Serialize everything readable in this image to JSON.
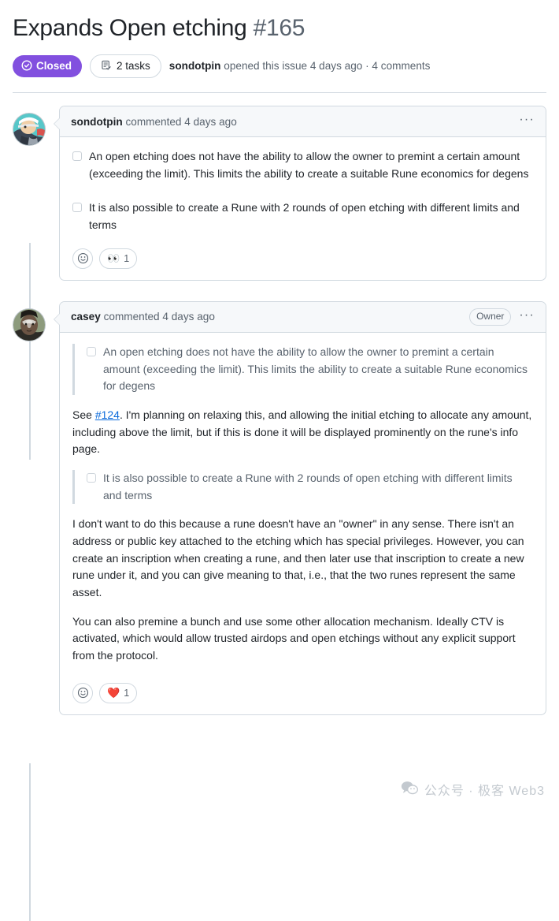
{
  "issue": {
    "title": "Expands Open etching",
    "number": "#165",
    "state_label": "Closed",
    "state_color": "#8250df",
    "tasks_label": "2 tasks",
    "meta_author": "sondotpin",
    "meta_text": " opened this issue 4 days ago · 4 comments"
  },
  "comments": [
    {
      "author": "sondotpin",
      "action": "commented 4 days ago",
      "badge": null,
      "kebab": "···",
      "tasks": [
        "An open etching does not have the ability to allow the owner to premint a certain amount (exceeding the limit). This limits the ability to create a suitable Rune economics for degens",
        "It is also possible to create a Rune with 2 rounds of open etching with different limits and terms"
      ],
      "reactions": [
        {
          "emoji": "👀",
          "count": "1",
          "name": "eyes-reaction"
        }
      ]
    },
    {
      "author": "casey",
      "action": "commented 4 days ago",
      "badge": "Owner",
      "kebab": "···",
      "quote1": "An open etching does not have the ability to allow the owner to premint a certain amount (exceeding the limit). This limits the ability to create a suitable Rune economics for degens",
      "para1_before": "See ",
      "para1_link": "#124",
      "para1_after": ". I'm planning on relaxing this, and allowing the initial etching to allocate any amount, including above the limit, but if this is done it will be displayed prominently on the rune's info page.",
      "quote2": "It is also possible to create a Rune with 2 rounds of open etching with different limits and terms",
      "para2": "I don't want to do this because a rune doesn't have an \"owner\" in any sense. There isn't an address or public key attached to the etching which has special privileges. However, you can create an inscription when creating a rune, and then later use that inscription to create a new rune under it, and you can give meaning to that, i.e., that the two runes represent the same asset.",
      "para3": "You can also premine a bunch and use some other allocation mechanism. Ideally CTV is activated, which would allow trusted airdops and open etchings without any explicit support from the protocol.",
      "reactions": [
        {
          "emoji": "❤️",
          "count": "1",
          "name": "heart-reaction"
        }
      ]
    }
  ],
  "watermark": {
    "text": "公众号 · 极客 Web3"
  }
}
